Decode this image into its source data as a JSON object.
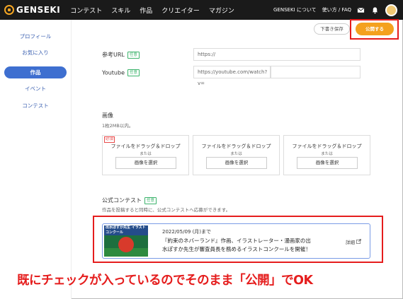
{
  "nav": {
    "logo": "GENSEKI",
    "links": [
      "コンテスト",
      "スキル",
      "作品",
      "クリエイター",
      "マガジン"
    ],
    "right_links": [
      "GENSEKI について",
      "使い方 / FAQ"
    ]
  },
  "sidebar": {
    "items": [
      {
        "label": "プロフィール"
      },
      {
        "label": "お気に入り"
      },
      {
        "label": "作品"
      },
      {
        "label": "イベント"
      },
      {
        "label": "コンテスト"
      }
    ]
  },
  "actions": {
    "draft": "下書き保存",
    "publish": "公開する"
  },
  "form": {
    "reference_url": {
      "label": "参考URL",
      "tag": "任意",
      "placeholder": "https://"
    },
    "youtube": {
      "label": "Youtube",
      "tag": "任意",
      "placeholder": "https://youtube.com/watch?v="
    },
    "image": {
      "label": "画像",
      "note": "1枚2MB以内。",
      "required_badge": "必須",
      "drop_text": "ファイルをドラッグ＆ドロップ",
      "or_text": "または",
      "select_button": "画像を選択"
    },
    "contest": {
      "label": "公式コンテスト",
      "tag": "任意",
      "note": "作品を投稿すると同時に、公式コンテストへ応募ができます。",
      "card": {
        "date": "2022/05/09 (月)まで",
        "line1": "『約束のネバーランド』作画、イラストレーター・漫画家の出",
        "line2": "水ぽすか先生が審査員長を務めるイラストコンクールを開催！",
        "detail": "詳細",
        "thumb_text": "出水ぽすか先生 イラストコンクール"
      }
    }
  },
  "caption": "既にチェックが入っているのでそのまま「公開」でOK",
  "colors": {
    "accent": "#f4a11e",
    "primary": "#3e6fd0",
    "highlight": "#e51d1d",
    "nav_bg": "#1a1a1a"
  }
}
